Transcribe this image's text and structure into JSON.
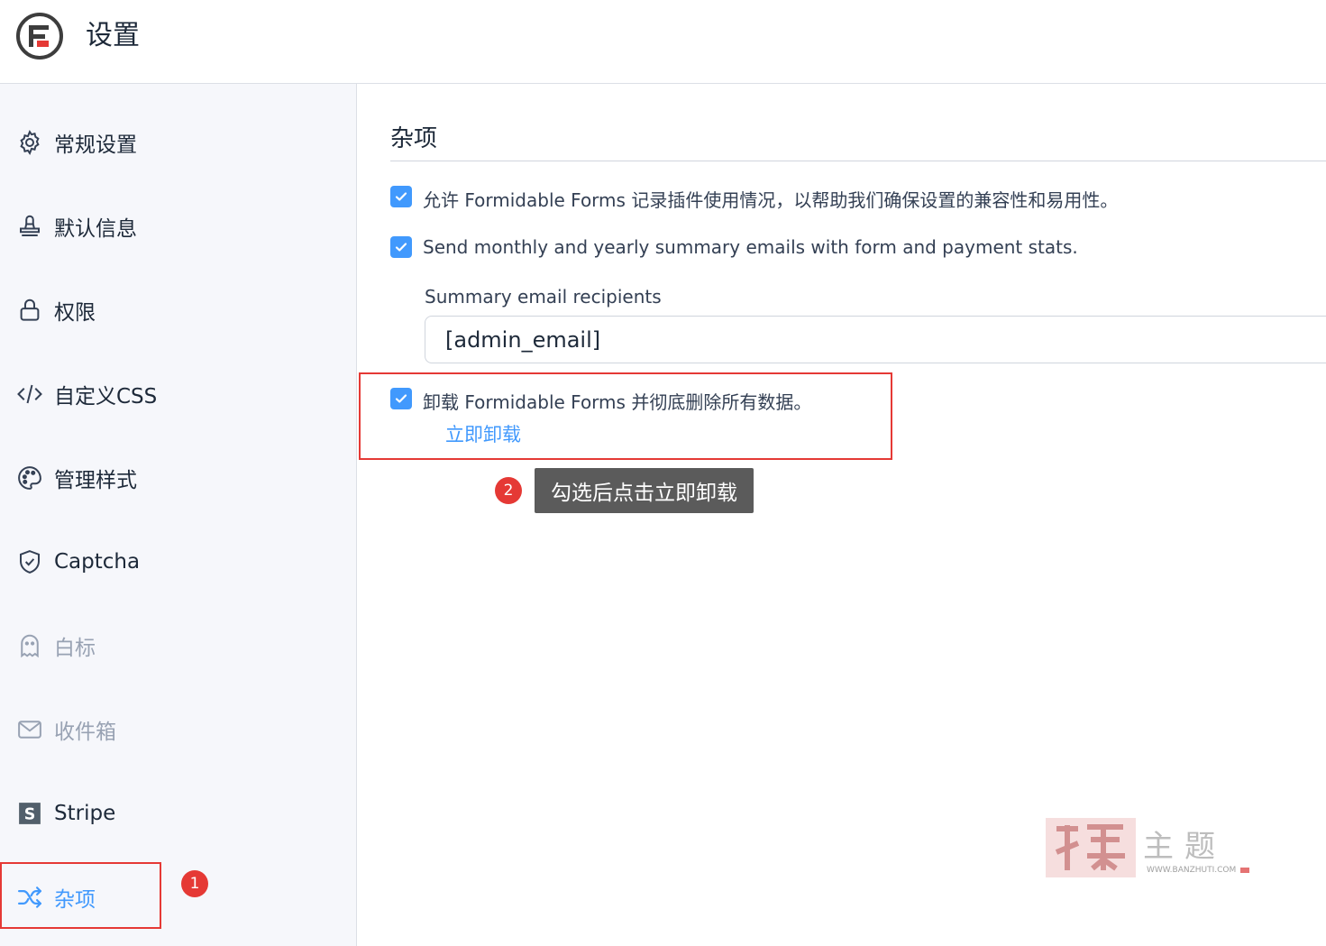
{
  "header": {
    "title": "设置",
    "logo_icon": "formidable-logo-icon"
  },
  "sidebar": {
    "items": [
      {
        "label": "常规设置",
        "icon": "gear-icon",
        "state": "normal"
      },
      {
        "label": "默认信息",
        "icon": "stamp-icon",
        "state": "normal"
      },
      {
        "label": "权限",
        "icon": "lock-icon",
        "state": "normal"
      },
      {
        "label": "自定义CSS",
        "icon": "code-icon",
        "state": "normal"
      },
      {
        "label": "管理样式",
        "icon": "palette-icon",
        "state": "normal"
      },
      {
        "label": "Captcha",
        "icon": "shield-check-icon",
        "state": "normal"
      },
      {
        "label": "白标",
        "icon": "ghost-icon",
        "state": "disabled"
      },
      {
        "label": "收件箱",
        "icon": "envelope-icon",
        "state": "disabled"
      },
      {
        "label": "Stripe",
        "icon": "stripe-icon",
        "state": "normal"
      },
      {
        "label": "杂项",
        "icon": "shuffle-icon",
        "state": "active"
      }
    ]
  },
  "main": {
    "section_title": "杂项",
    "options": {
      "usage_tracking": {
        "label": "允许 Formidable Forms 记录插件使用情况，以帮助我们确保设置的兼容性和易用性。",
        "checked": true
      },
      "summary_emails": {
        "label": "Send monthly and yearly summary emails with form and payment stats.",
        "checked": true
      },
      "uninstall": {
        "label": "卸载 Formidable Forms 并彻底删除所有数据。",
        "checked": true,
        "link": "立即卸载"
      }
    },
    "recipients": {
      "label": "Summary email recipients",
      "value": "[admin_email]"
    }
  },
  "annotations": {
    "badge_1": "1",
    "badge_2": "2",
    "tooltip": "勾选后点击立即卸载",
    "highlight_color": "#e53935"
  },
  "watermark": {
    "text": "主题",
    "site": "WWW.BANZHUTI.COM"
  },
  "colors": {
    "accent": "#4199fd",
    "text": "#1d2939",
    "muted": "#98a2b3",
    "sidebar_bg": "#f6f7fb"
  }
}
